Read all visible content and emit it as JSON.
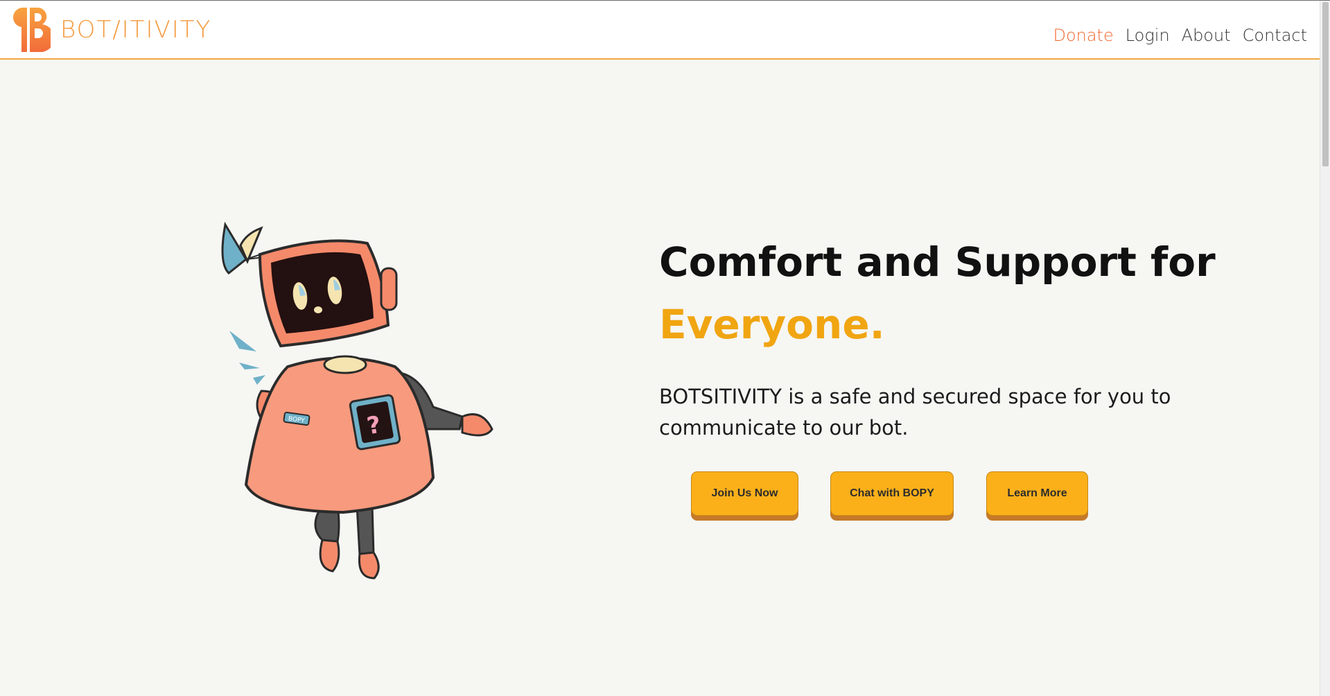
{
  "header": {
    "brand": "BOT/ITIVITY",
    "nav": {
      "donate": "Donate",
      "login": "Login",
      "about": "About",
      "contact": "Contact"
    }
  },
  "hero": {
    "title_line1": "Comfort and Support for",
    "title_accent": "Everyone.",
    "description": "BOTSITIVITY is a safe and secured space for you to communicate to our bot.",
    "buttons": {
      "join": "Join Us Now",
      "chat": "Chat with BOPY",
      "learn": "Learn More"
    },
    "robot_badge": "BOPY",
    "robot_screen_symbol": "?"
  },
  "colors": {
    "accent_orange": "#f39a3d",
    "donate": "#f2682f",
    "title_accent": "#f0a511",
    "button": "#fbb01a",
    "header_rule": "#f3a63d"
  }
}
